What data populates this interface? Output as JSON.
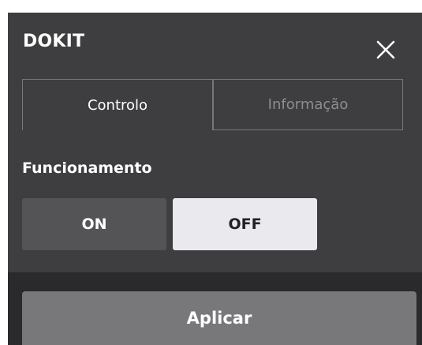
{
  "dialog": {
    "title": "DOKIT",
    "close_icon": "close-icon"
  },
  "tabs": [
    {
      "label": "Controlo",
      "active": true
    },
    {
      "label": "Informação",
      "active": false
    }
  ],
  "operation": {
    "label": "Funcionamento",
    "on_label": "ON",
    "off_label": "OFF",
    "selected": "OFF"
  },
  "footer": {
    "apply_label": "Aplicar"
  },
  "colors": {
    "panel_bg": "#3e3e40",
    "footer_bg": "#2a2a2c",
    "apply_bg": "#78787b",
    "toggle_selected_bg": "#e9e9ee",
    "toggle_unselected_bg": "#545457",
    "tab_border": "#77777a"
  }
}
